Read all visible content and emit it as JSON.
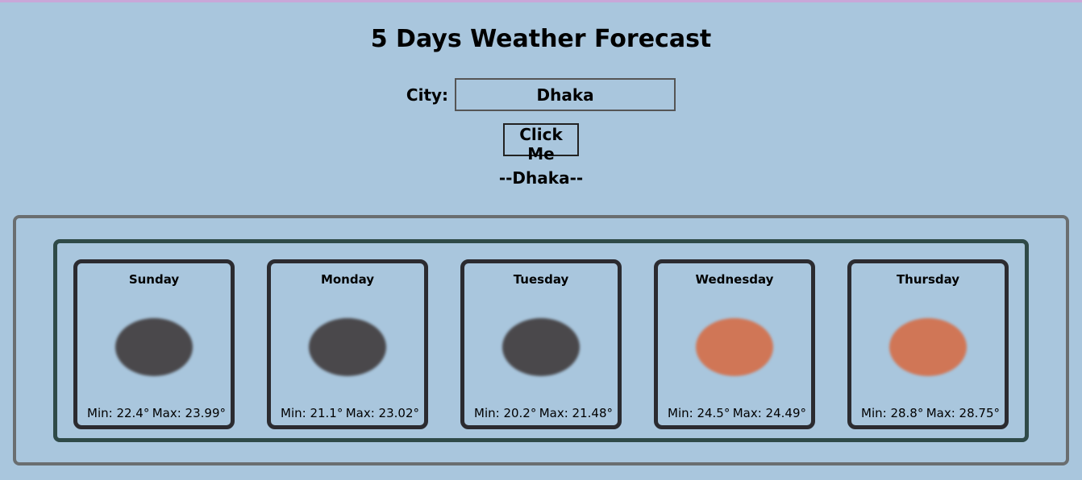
{
  "header": {
    "title": "5 Days Weather Forecast"
  },
  "search": {
    "label": "City:",
    "value": "Dhaka",
    "button_label": "Click Me"
  },
  "result": {
    "city_heading": "--Dhaka--"
  },
  "forecast": [
    {
      "day": "Sunday",
      "icon": "weather-overcast-icon",
      "color": "#4a484b",
      "min": "Min: 22.4°",
      "max": "Max: 23.99°"
    },
    {
      "day": "Monday",
      "icon": "weather-overcast-icon",
      "color": "#4a484b",
      "min": "Min: 21.1°",
      "max": "Max: 23.02°"
    },
    {
      "day": "Tuesday",
      "icon": "weather-overcast-icon",
      "color": "#4a484b",
      "min": "Min: 20.2°",
      "max": "Max: 21.48°"
    },
    {
      "day": "Wednesday",
      "icon": "weather-clear-icon",
      "color": "#d07656",
      "min": "Min: 24.5°",
      "max": "Max: 24.49°"
    },
    {
      "day": "Thursday",
      "icon": "weather-clear-icon",
      "color": "#d07656",
      "min": "Min: 28.8°",
      "max": "Max: 28.75°"
    }
  ]
}
